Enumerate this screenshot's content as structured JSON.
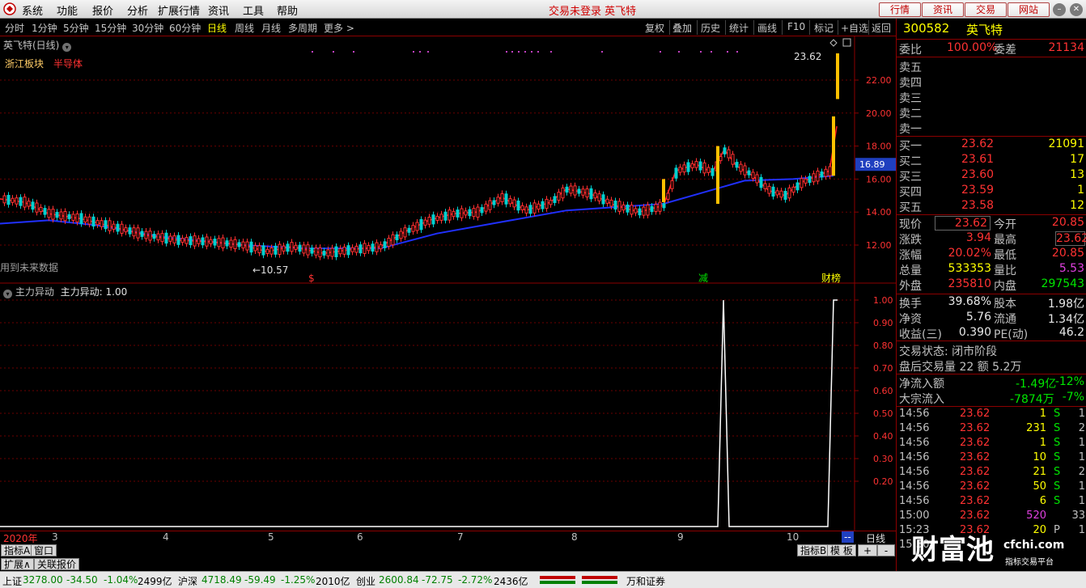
{
  "menubar": {
    "items": [
      "系统",
      "功能",
      "报价",
      "分析",
      "扩展行情",
      "资讯",
      "工具",
      "帮助"
    ],
    "center_title": "交易未登录  英飞特",
    "buttons": [
      "行情",
      "资讯",
      "交易",
      "网站"
    ]
  },
  "periods": [
    "分时",
    "1分钟",
    "5分钟",
    "15分钟",
    "30分钟",
    "60分钟",
    "日线",
    "周线",
    "月线",
    "多周期",
    "更多 >"
  ],
  "active_period": "日线",
  "tools": [
    "复权",
    "叠加",
    "历史",
    "统计",
    "画线",
    "F10",
    "标记",
    "+自选",
    "返回"
  ],
  "main_chart": {
    "title": "英飞特(日线)",
    "block": "浙江板块",
    "concept": "半导体",
    "note": "用到未来数据",
    "y_ticks": [
      "22.00",
      "20.00",
      "18.00",
      "16.00",
      "14.00",
      "12.00"
    ],
    "current_price_tag": "16.89",
    "high_label": "23.62",
    "low_label": "←10.57",
    "markers": [
      "$",
      "减",
      "财榜"
    ]
  },
  "indicator": {
    "title": "主力异动",
    "value_label": "主力异动: 1.00",
    "y_ticks": [
      "1.00",
      "0.90",
      "0.80",
      "0.70",
      "0.60",
      "0.50",
      "0.40",
      "0.30",
      "0.20"
    ]
  },
  "date_axis": {
    "labels": [
      "2020年",
      "3",
      "4",
      "5",
      "6",
      "7",
      "8",
      "9",
      "10"
    ],
    "right_label": "日线",
    "minus_btn": "--"
  },
  "tabs": {
    "row1": [
      "指标A",
      "窗口"
    ],
    "row1_right": [
      "指标B",
      "模 板",
      "+",
      "-"
    ],
    "row2": [
      "扩展∧",
      "关联报价"
    ]
  },
  "status": {
    "sh_label": "上证",
    "sh_price": "3278.00",
    "sh_change": "-34.50",
    "sh_pct": "-1.04%",
    "sh_amount": "2499亿",
    "sz_label": "沪深",
    "sz_price": "4718.49",
    "sz_change": "-59.49",
    "sz_pct": "-1.25%",
    "sz_amount": "2010亿",
    "cy_label": "创业",
    "cy_price": "2600.84",
    "cy_change": "-72.75",
    "cy_pct": "-2.72%",
    "cy_amount": "2436亿",
    "broker": "万和证券"
  },
  "quote": {
    "code": "300582",
    "name": "英飞特",
    "weibi_label": "委比",
    "weibi": "100.00%",
    "weicha_label": "委差",
    "weicha": "21134",
    "sells": [
      {
        "label": "卖五",
        "price": "",
        "vol": ""
      },
      {
        "label": "卖四",
        "price": "",
        "vol": ""
      },
      {
        "label": "卖三",
        "price": "",
        "vol": ""
      },
      {
        "label": "卖二",
        "price": "",
        "vol": ""
      },
      {
        "label": "卖一",
        "price": "",
        "vol": ""
      }
    ],
    "buys": [
      {
        "label": "买一",
        "price": "23.62",
        "vol": "21091"
      },
      {
        "label": "买二",
        "price": "23.61",
        "vol": "17"
      },
      {
        "label": "买三",
        "price": "23.60",
        "vol": "13"
      },
      {
        "label": "买四",
        "price": "23.59",
        "vol": "1"
      },
      {
        "label": "买五",
        "price": "23.58",
        "vol": "12"
      }
    ],
    "stats": [
      {
        "l1": "现价",
        "v1": "23.62",
        "l2": "今开",
        "v2": "20.85"
      },
      {
        "l1": "涨跌",
        "v1": "3.94",
        "l2": "最高",
        "v2": "23.62"
      },
      {
        "l1": "涨幅",
        "v1": "20.02%",
        "l2": "最低",
        "v2": "20.85"
      },
      {
        "l1": "总量",
        "v1": "533353",
        "l2": "量比",
        "v2": "5.53"
      },
      {
        "l1": "外盘",
        "v1": "235810",
        "l2": "内盘",
        "v2": "297543"
      }
    ],
    "stats2": [
      {
        "l1": "换手",
        "v1": "39.68%",
        "l2": "股本",
        "v2": "1.98亿"
      },
      {
        "l1": "净资",
        "v1": "5.76",
        "l2": "流通",
        "v2": "1.34亿"
      },
      {
        "l1": "收益(三)",
        "v1": "0.390",
        "l2": "PE(动)",
        "v2": "46.2"
      }
    ],
    "trade_state": "交易状态: 闭市阶段",
    "after_hours": "盘后交易量 22 额 5.2万",
    "net_inflow_label": "净流入额",
    "net_inflow": "-1.49亿",
    "net_inflow_pct": "-12%",
    "block_inflow_label": "大宗流入",
    "block_inflow": "-7874万",
    "block_inflow_pct": "-7%"
  },
  "ticks": [
    {
      "time": "14:56",
      "price": "23.62",
      "vol": "1",
      "side": "S",
      "n": "1"
    },
    {
      "time": "14:56",
      "price": "23.62",
      "vol": "231",
      "side": "S",
      "n": "2"
    },
    {
      "time": "14:56",
      "price": "23.62",
      "vol": "1",
      "side": "S",
      "n": "1"
    },
    {
      "time": "14:56",
      "price": "23.62",
      "vol": "10",
      "side": "S",
      "n": "1"
    },
    {
      "time": "14:56",
      "price": "23.62",
      "vol": "21",
      "side": "S",
      "n": "2"
    },
    {
      "time": "14:56",
      "price": "23.62",
      "vol": "50",
      "side": "S",
      "n": "1"
    },
    {
      "time": "14:56",
      "price": "23.62",
      "vol": "6",
      "side": "S",
      "n": "1"
    },
    {
      "time": "15:00",
      "price": "23.62",
      "vol": "520",
      "side": "",
      "n": "33"
    },
    {
      "time": "15:23",
      "price": "23.62",
      "vol": "20",
      "side": "P",
      "n": "1"
    },
    {
      "time": "15:30",
      "price": "",
      "vol": "",
      "side": "",
      "n": ""
    }
  ],
  "watermark": {
    "brand": "财富池",
    "site": "cfchi.com",
    "sub": "指标交易平台"
  }
}
